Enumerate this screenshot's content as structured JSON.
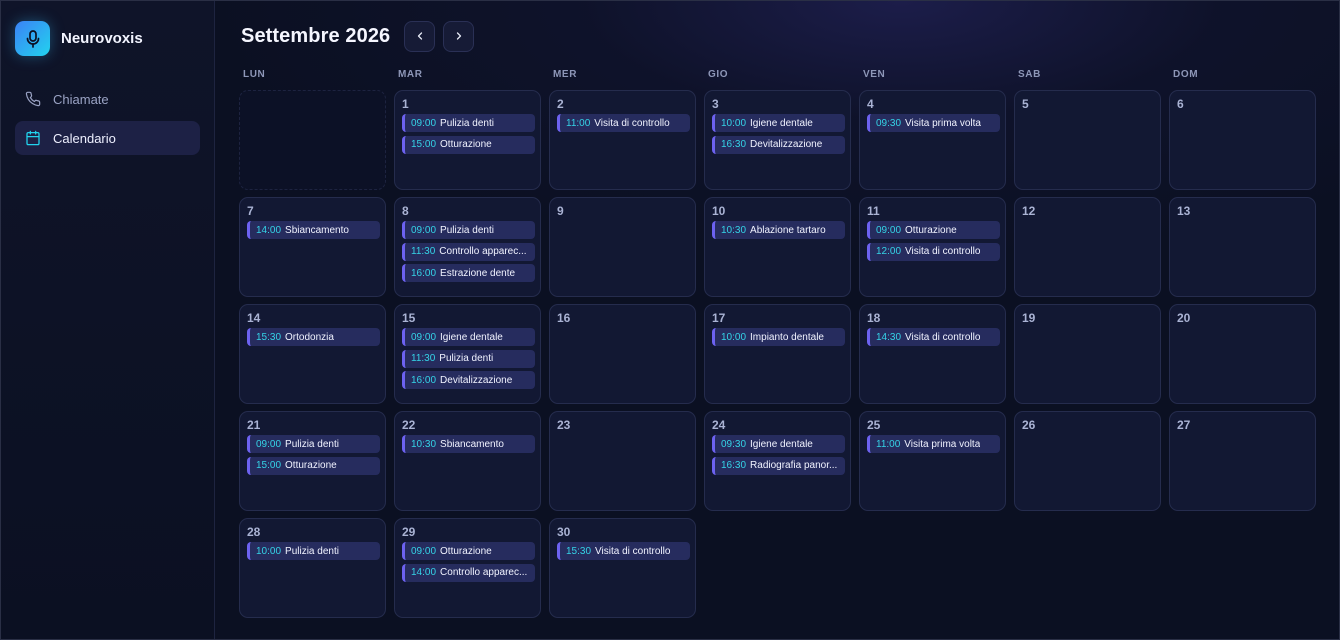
{
  "app": {
    "name": "Neurovoxis"
  },
  "sidebar": {
    "items": [
      {
        "label": "Chiamate",
        "icon": "phone-icon",
        "active": false
      },
      {
        "label": "Calendario",
        "icon": "calendar-icon",
        "active": true
      }
    ]
  },
  "calendar": {
    "title": "Settembre 2026",
    "weekdays": [
      "LUN",
      "MAR",
      "MER",
      "GIO",
      "VEN",
      "SAB",
      "DOM"
    ],
    "leading_empty": 1,
    "days": [
      {
        "day": "1",
        "events": [
          {
            "time": "09:00",
            "title": "Pulizia denti"
          },
          {
            "time": "15:00",
            "title": "Otturazione"
          }
        ]
      },
      {
        "day": "2",
        "events": [
          {
            "time": "11:00",
            "title": "Visita di controllo"
          }
        ]
      },
      {
        "day": "3",
        "events": [
          {
            "time": "10:00",
            "title": "Igiene dentale"
          },
          {
            "time": "16:30",
            "title": "Devitalizzazione"
          }
        ]
      },
      {
        "day": "4",
        "events": [
          {
            "time": "09:30",
            "title": "Visita prima volta"
          }
        ]
      },
      {
        "day": "5",
        "events": []
      },
      {
        "day": "6",
        "events": []
      },
      {
        "day": "7",
        "events": [
          {
            "time": "14:00",
            "title": "Sbiancamento"
          }
        ]
      },
      {
        "day": "8",
        "events": [
          {
            "time": "09:00",
            "title": "Pulizia denti"
          },
          {
            "time": "11:30",
            "title": "Controllo apparec..."
          },
          {
            "time": "16:00",
            "title": "Estrazione dente"
          }
        ]
      },
      {
        "day": "9",
        "events": []
      },
      {
        "day": "10",
        "events": [
          {
            "time": "10:30",
            "title": "Ablazione tartaro"
          }
        ]
      },
      {
        "day": "11",
        "events": [
          {
            "time": "09:00",
            "title": "Otturazione"
          },
          {
            "time": "12:00",
            "title": "Visita di controllo"
          }
        ]
      },
      {
        "day": "12",
        "events": []
      },
      {
        "day": "13",
        "events": []
      },
      {
        "day": "14",
        "events": [
          {
            "time": "15:30",
            "title": "Ortodonzia"
          }
        ]
      },
      {
        "day": "15",
        "events": [
          {
            "time": "09:00",
            "title": "Igiene dentale"
          },
          {
            "time": "11:30",
            "title": "Pulizia denti"
          },
          {
            "time": "16:00",
            "title": "Devitalizzazione"
          }
        ]
      },
      {
        "day": "16",
        "events": []
      },
      {
        "day": "17",
        "events": [
          {
            "time": "10:00",
            "title": "Impianto dentale"
          }
        ]
      },
      {
        "day": "18",
        "events": [
          {
            "time": "14:30",
            "title": "Visita di controllo"
          }
        ]
      },
      {
        "day": "19",
        "events": []
      },
      {
        "day": "20",
        "events": []
      },
      {
        "day": "21",
        "events": [
          {
            "time": "09:00",
            "title": "Pulizia denti"
          },
          {
            "time": "15:00",
            "title": "Otturazione"
          }
        ]
      },
      {
        "day": "22",
        "events": [
          {
            "time": "10:30",
            "title": "Sbiancamento"
          }
        ]
      },
      {
        "day": "23",
        "events": []
      },
      {
        "day": "24",
        "events": [
          {
            "time": "09:30",
            "title": "Igiene dentale"
          },
          {
            "time": "16:30",
            "title": "Radiografia panor..."
          }
        ]
      },
      {
        "day": "25",
        "events": [
          {
            "time": "11:00",
            "title": "Visita prima volta"
          }
        ]
      },
      {
        "day": "26",
        "events": []
      },
      {
        "day": "27",
        "events": []
      },
      {
        "day": "28",
        "events": [
          {
            "time": "10:00",
            "title": "Pulizia denti"
          }
        ]
      },
      {
        "day": "29",
        "events": [
          {
            "time": "09:00",
            "title": "Otturazione"
          },
          {
            "time": "14:00",
            "title": "Controllo apparec..."
          }
        ]
      },
      {
        "day": "30",
        "events": [
          {
            "time": "15:30",
            "title": "Visita di controllo"
          }
        ]
      }
    ]
  },
  "colors": {
    "accent": "#6d62f0",
    "time": "#35d3e6",
    "background": "#0b1022"
  }
}
